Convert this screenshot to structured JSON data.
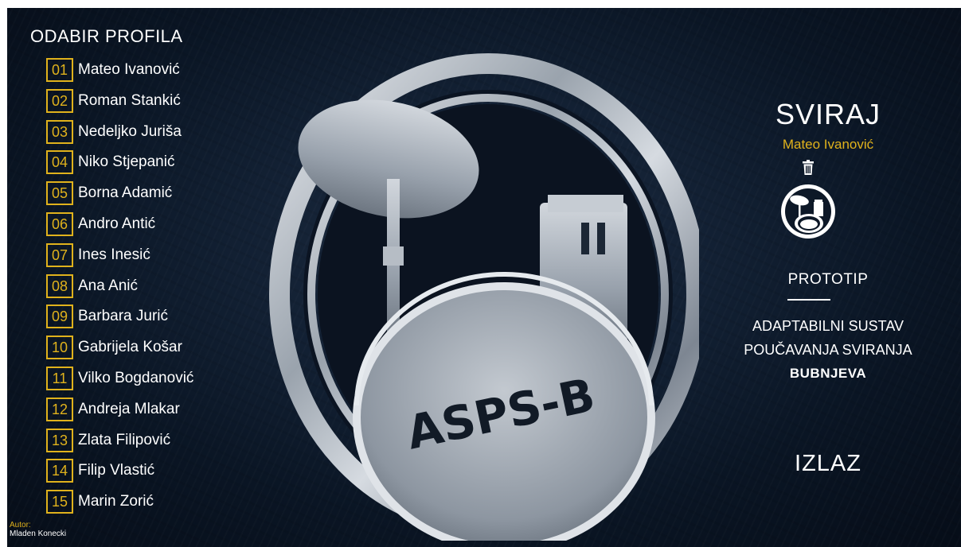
{
  "header": {
    "title": "ODABIR PROFILA"
  },
  "profiles": [
    {
      "num": "01",
      "name": "Mateo Ivanović"
    },
    {
      "num": "02",
      "name": "Roman Stankić"
    },
    {
      "num": "03",
      "name": "Nedeljko Juriša"
    },
    {
      "num": "04",
      "name": "Niko Stjepanić"
    },
    {
      "num": "05",
      "name": "Borna Adamić"
    },
    {
      "num": "06",
      "name": "Andro Antić"
    },
    {
      "num": "07",
      "name": "Ines Inesić"
    },
    {
      "num": "08",
      "name": "Ana Anić"
    },
    {
      "num": "09",
      "name": "Barbara Jurić"
    },
    {
      "num": "10",
      "name": "Gabrijela Košar"
    },
    {
      "num": "11",
      "name": "Vilko Bogdanović"
    },
    {
      "num": "12",
      "name": "Andreja Mlakar"
    },
    {
      "num": "13",
      "name": "Zlata Filipović"
    },
    {
      "num": "14",
      "name": "Filip Vlastić"
    },
    {
      "num": "15",
      "name": "Marin Zorić"
    }
  ],
  "logo": {
    "text": "ASPS-B"
  },
  "right_panel": {
    "play_label": "SVIRAJ",
    "selected_profile": "Mateo Ivanović",
    "trash_icon": "trash-icon",
    "drum_icon": "drum-kit-icon",
    "prototype_label": "PROTOTIP",
    "description_line1": "ADAPTABILNI SUSTAV",
    "description_line2": "POUČAVANJA SVIRANJA",
    "description_line3": "BUBNJEVA",
    "exit_label": "IZLAZ"
  },
  "footer": {
    "author_label": "Autor:",
    "author_name": "Mladen Konecki"
  },
  "colors": {
    "accent": "#e0b21c",
    "background": "#0e1a2b",
    "text": "#ffffff"
  }
}
